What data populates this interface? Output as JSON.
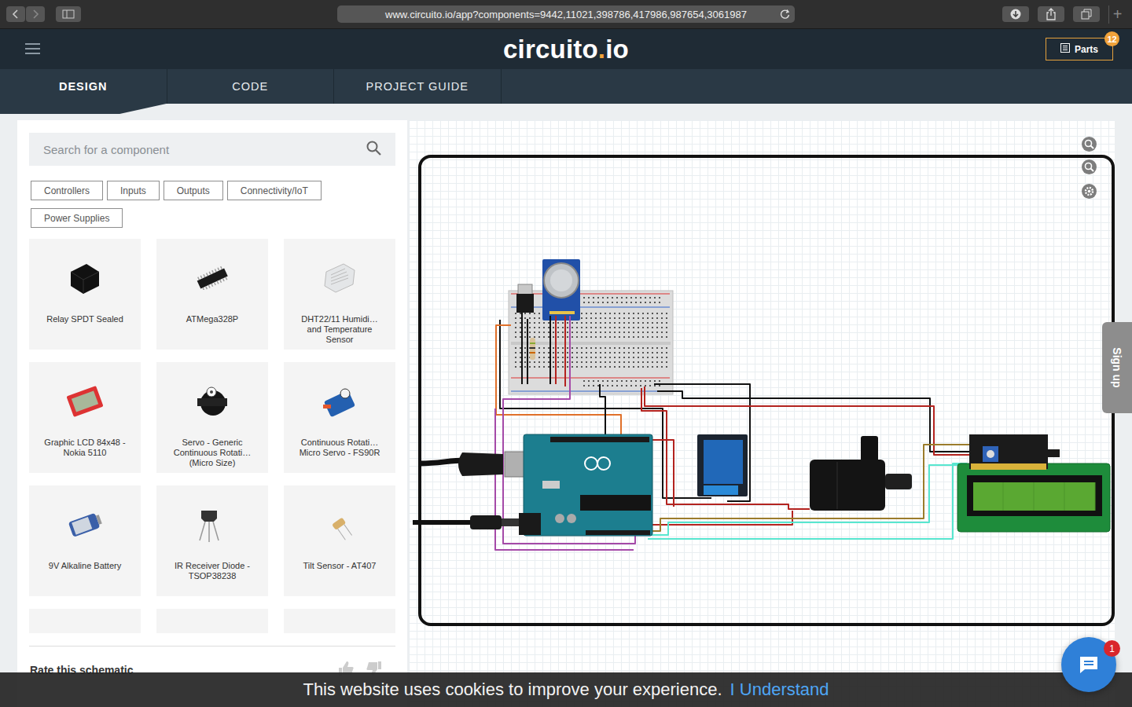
{
  "browser": {
    "url": "www.circuito.io/app?components=9442,11021,398786,417986,987654,3061987",
    "new_tab": "+"
  },
  "header": {
    "logo": {
      "main": "circuito",
      "dot": ".",
      "suffix": "io"
    },
    "parts_button": {
      "label": "Parts",
      "badge": "12"
    }
  },
  "tabs": [
    {
      "label": "DESIGN",
      "selected": true
    },
    {
      "label": "CODE",
      "selected": false
    },
    {
      "label": "PROJECT GUIDE",
      "selected": false
    }
  ],
  "search": {
    "placeholder": "Search for a component"
  },
  "filters": [
    "Controllers",
    "Inputs",
    "Outputs",
    "Connectivity/IoT",
    "Power Supplies"
  ],
  "components": [
    {
      "name": "Relay SPDT Sealed"
    },
    {
      "name": "ATMega328P"
    },
    {
      "name": "DHT22/11 Humidi… and Temperature Sensor"
    },
    {
      "name": "Graphic LCD 84x48 - Nokia 5110"
    },
    {
      "name": "Servo - Generic Continuous Rotati… (Micro Size)"
    },
    {
      "name": "Continuous Rotati… Micro Servo - FS90R"
    },
    {
      "name": "9V Alkaline Battery"
    },
    {
      "name": "IR Receiver Diode - TSOP38238"
    },
    {
      "name": "Tilt Sensor - AT407"
    }
  ],
  "rate": {
    "label": "Rate this schematic"
  },
  "canvas": {
    "side_tab": "Sign up"
  },
  "chat": {
    "badge": "1"
  },
  "cookie": {
    "message": "This website uses cookies to improve your experience.",
    "action": "I Understand"
  }
}
